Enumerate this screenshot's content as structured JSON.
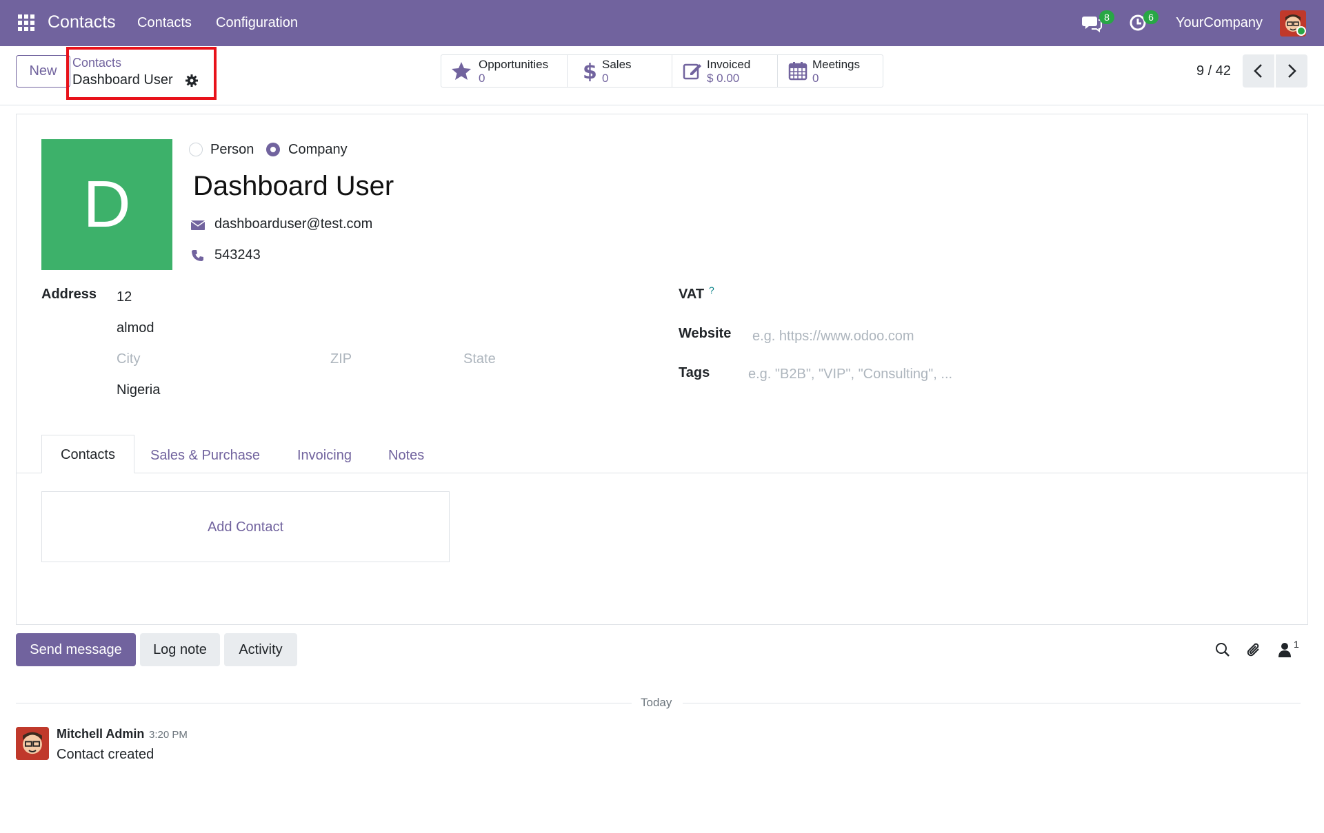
{
  "navbar": {
    "app_name": "Contacts",
    "menus": [
      "Contacts",
      "Configuration"
    ],
    "messages_badge": "8",
    "activities_badge": "6",
    "company": "YourCompany",
    "apps_icon": "grid-apps-icon",
    "messages_icon": "chat-bubbles-icon",
    "activities_icon": "clock-icon",
    "accent": "#71639e"
  },
  "control": {
    "new_label": "New",
    "breadcrumb_parent": "Contacts",
    "breadcrumb_current": "Dashboard User",
    "smart_buttons": [
      {
        "label": "Opportunities",
        "value": "0",
        "icon": "star-icon"
      },
      {
        "label": "Sales",
        "value": "0",
        "icon": "dollar-icon"
      },
      {
        "label": "Invoiced",
        "value": "$ 0.00",
        "icon": "invoice-edit-icon"
      },
      {
        "label": "Meetings",
        "value": "0",
        "icon": "calendar-icon"
      }
    ],
    "pager": "9 / 42"
  },
  "form": {
    "avatar_letter": "D",
    "avatar_color": "#3db16a",
    "type_person": "Person",
    "type_company": "Company",
    "name": "Dashboard User",
    "email": "dashboarduser@test.com",
    "phone": "543243",
    "address_label": "Address",
    "street": "12",
    "street2": "almod",
    "city_placeholder": "City",
    "zip_placeholder": "ZIP",
    "state_placeholder": "State",
    "country": "Nigeria",
    "vat_label": "VAT",
    "vat_help": "?",
    "website_label": "Website",
    "website_placeholder": "e.g. https://www.odoo.com",
    "tags_label": "Tags",
    "tags_placeholder": "e.g. \"B2B\", \"VIP\", \"Consulting\", ...",
    "tabs": [
      "Contacts",
      "Sales & Purchase",
      "Invoicing",
      "Notes"
    ],
    "add_contact": "Add Contact"
  },
  "chatter": {
    "send_message": "Send message",
    "log_note": "Log note",
    "activity": "Activity",
    "followers_count": "1",
    "date_separator": "Today",
    "messages": [
      {
        "author": "Mitchell Admin",
        "time": "3:20 PM",
        "body": "Contact created"
      }
    ]
  }
}
